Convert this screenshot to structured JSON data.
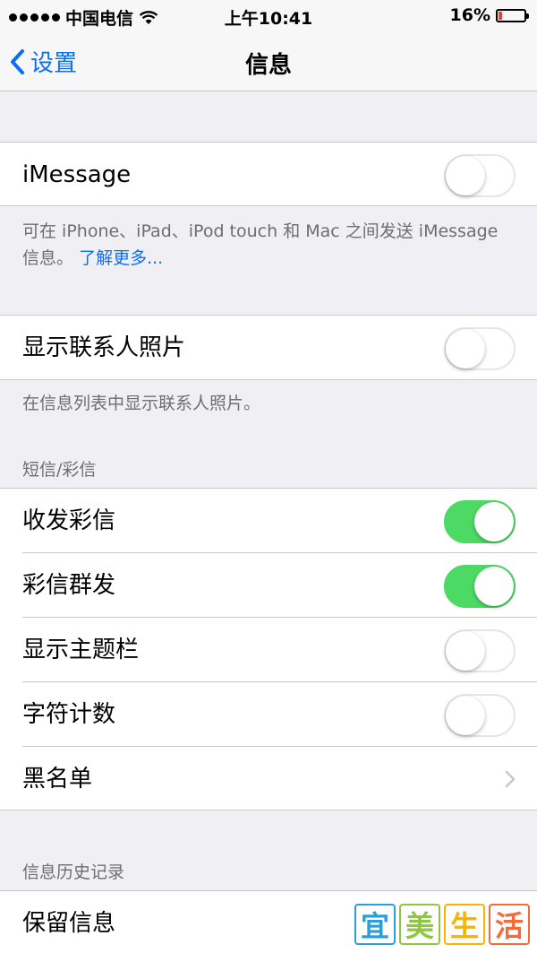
{
  "status_bar": {
    "carrier": "中国电信",
    "time": "上午10:41",
    "battery": "16%",
    "battery_level": 0.16
  },
  "nav": {
    "back_label": "设置",
    "title": "信息"
  },
  "imessage": {
    "label": "iMessage",
    "enabled": false,
    "footer_text": "可在 iPhone、iPad、iPod touch 和 Mac 之间发送 iMessage 信息。",
    "footer_link": "了解更多..."
  },
  "contact_photos": {
    "label": "显示联系人照片",
    "enabled": false,
    "footer_text": "在信息列表中显示联系人照片。"
  },
  "sms_mms": {
    "header": "短信/彩信",
    "items": [
      {
        "label": "收发彩信",
        "type": "toggle",
        "enabled": true
      },
      {
        "label": "彩信群发",
        "type": "toggle",
        "enabled": true
      },
      {
        "label": "显示主题栏",
        "type": "toggle",
        "enabled": false
      },
      {
        "label": "字符计数",
        "type": "toggle",
        "enabled": false
      },
      {
        "label": "黑名单",
        "type": "chevron"
      }
    ]
  },
  "history": {
    "header": "信息历史记录",
    "items": [
      {
        "label": "保留信息"
      }
    ]
  },
  "watermark": {
    "chars": [
      "宜",
      "美",
      "生",
      "活"
    ],
    "colors": [
      "#2a9fd8",
      "#8dc63f",
      "#f7b500",
      "#f26b3a"
    ]
  },
  "colors": {
    "accent": "#0a6ff6",
    "toggle_on": "#4cd964",
    "battery_low": "#ff3b30",
    "background": "#efeff4"
  }
}
